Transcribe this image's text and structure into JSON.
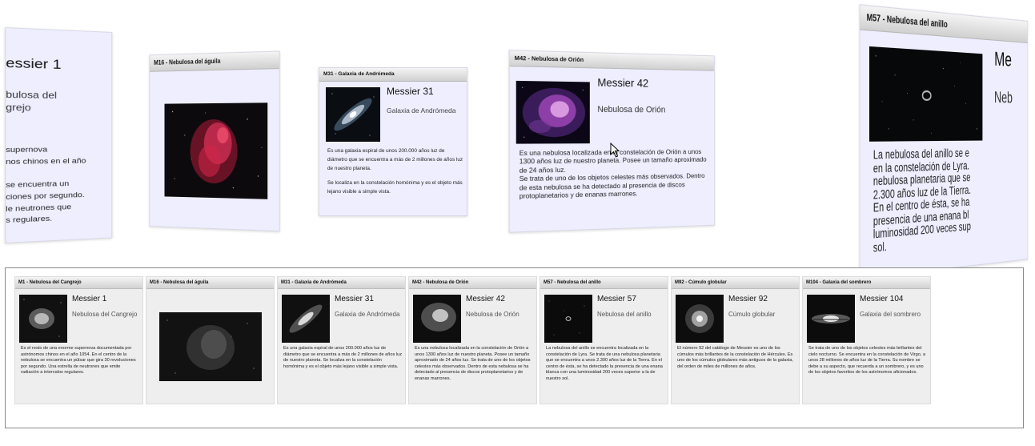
{
  "carousel": {
    "left": {
      "title": "essier 1",
      "subtitle_lines": [
        "bulosa del",
        "grejo"
      ],
      "desc_lines": [
        "supernova",
        "nos chinos en el año",
        "",
        "se encuentra un",
        "ciones por segundo.",
        "le neutrones que",
        "s regulares."
      ]
    },
    "m16": {
      "header": "M16 - Nebulosa del águila"
    },
    "m31": {
      "header": "M31 - Galaxia de Andrómeda",
      "title": "Messier 31",
      "subtitle": "Galaxia de Andrómeda",
      "desc": "Es una galaxia espiral de unos 200.000 años luz de diámetro que se encuentra a más de 2 millones de años luz de nuestro planeta.",
      "desc2": "Se localiza en la constelación homónima y es el objeto más lejano visible a simple vista."
    },
    "m42": {
      "header": "M42 - Nebulosa de Orión",
      "title": "Messier 42",
      "subtitle": "Nebulosa de Orión",
      "desc": "Es una nebulosa localizada en la constelación de Orión a unos 1300 años luz de nuestro planeta. Posee un tamaño aproximado de 24 años luz.",
      "desc2": "Se trata de uno de los objetos celestes más observados. Dentro de esta nebulosa se ha detectado al presencia de discos protoplanetarios y de enanas marrones."
    },
    "m57": {
      "header": "M57 - Nebulosa del anillo",
      "title": "Me",
      "subtitle": "Neb",
      "desc_lines": [
        "La nebulosa del anillo se e",
        "en la constelación de Lyra.",
        "nebulosa planetaria que se",
        "2.300 años luz de la Tierra.",
        "En el centro de ésta, se ha",
        "presencia de una enana bl",
        "luminosidad 200 veces sup",
        "sol."
      ]
    }
  },
  "strip": {
    "tiles": [
      {
        "header": "M1 - Nebulosa del Cangrejo",
        "title": "Messier 1",
        "subtitle": "Nebulosa del Cangrejo",
        "desc": "Es el resto de una enorme supernova documentada por astrónomos chinos en el año 1054. En el centro de la nebulosa se encuentra un púlsar que gira 30 revoluciones por segundo. Una estrella de neutrones que emite radiación a intervalos regulares."
      },
      {
        "header": "M16 - Nebulosa del águila",
        "title": "",
        "subtitle": "",
        "desc": ""
      },
      {
        "header": "M31 - Galaxia de Andrómeda",
        "title": "Messier 31",
        "subtitle": "Galaxia de Andrómeda",
        "desc": "Es una galaxia espiral de unos 200.000 años luz de diámetro que se encuentra a más de 2 millones de años luz de nuestro planeta. Se localiza en la constelación homónima y es el objeto más lejano visible a simple vista."
      },
      {
        "header": "M42 - Nebulosa de Orión",
        "title": "Messier 42",
        "subtitle": "Nebulosa de Orión",
        "desc": "Es una nebulosa localizada en la constelación de Orión a unos 1300 años luz de nuestro planeta. Posee un tamaño aproximado de 24 años luz. Se trata de uno de los objetos celestes más observados. Dentro de esta nebulosa se ha detectado al presencia de discos protoplanetarios y de enanas marrones."
      },
      {
        "header": "M57 - Nebulosa del anillo",
        "title": "Messier 57",
        "subtitle": "Nebulosa del anillo",
        "desc": "La nebulosa del anillo se encuentra localizada en la constelación de Lyra. Se trata de una nebulosa planetaria que se encuentra a unos 2.300 años luz de la Tierra. En el centro de ésta, se ha detectado la presencia de una enana blanca con una luminosidad 200 veces superior a la de nuestro sol."
      },
      {
        "header": "M92 - Cúmulo globular",
        "title": "Messier 92",
        "subtitle": "Cúmulo globular",
        "desc": "El número 92 del catálogo de Messier es uno de los cúmulos más brillantes de la constelación de Hércules. Es uno de los cúmulos globulares más antiguos de la galaxia, del orden de miles de millones de años."
      },
      {
        "header": "M104 - Galaxia del sombrero",
        "title": "Messier 104",
        "subtitle": "Galaxia del sombrero",
        "desc": "Se trata de uno de los objetos celestes más brillantes del cielo nocturno. Se encuentra en la constelación de Virgo, a unos 28 millones de años luz de la Tierra. Su nombre se debe a su aspecto, que recuerda a un sombrero, y es uno de los objetos favoritos de los astrónomos aficionados."
      }
    ]
  },
  "icons": {
    "cursor": "mouse-pointer-icon"
  }
}
